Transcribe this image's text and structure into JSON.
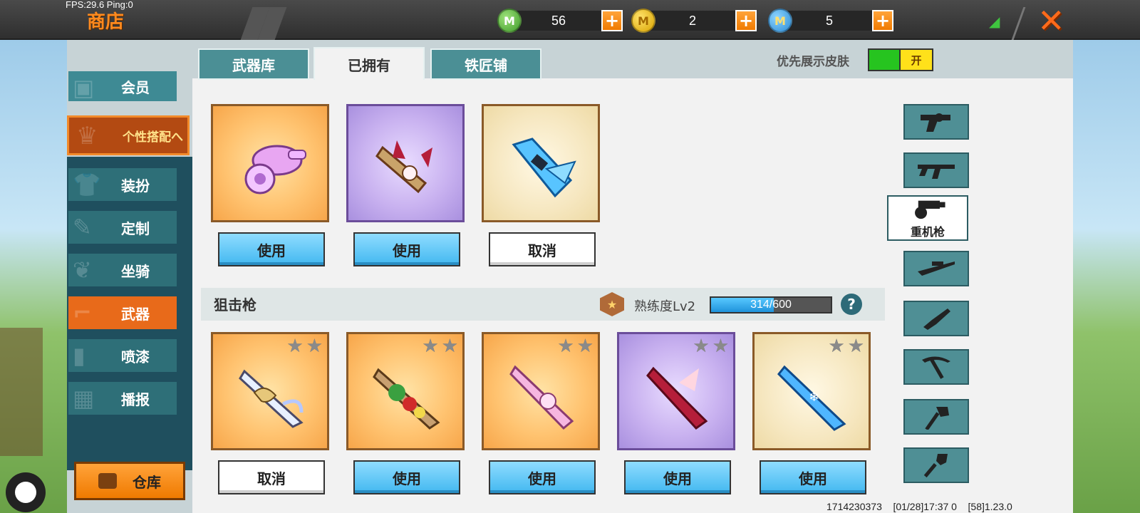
{
  "status": {
    "fps": "FPS:29.6  Ping:0"
  },
  "header": {
    "title": "商店",
    "currencies": [
      {
        "icon": "green-gem-icon",
        "value": "56"
      },
      {
        "icon": "gold-coin-icon",
        "value": "2"
      },
      {
        "icon": "blue-coin-icon",
        "value": "5"
      }
    ]
  },
  "sidebar": {
    "member": "会员",
    "group": "个性搭配へ",
    "items": [
      {
        "label": "装扮"
      },
      {
        "label": "定制"
      },
      {
        "label": "坐骑"
      },
      {
        "label": "武器"
      },
      {
        "label": "喷漆"
      },
      {
        "label": "播报"
      }
    ],
    "active_item": "武器",
    "warehouse": "仓库"
  },
  "tabs": [
    {
      "label": "武器库"
    },
    {
      "label": "已拥有"
    },
    {
      "label": "铁匠铺"
    }
  ],
  "active_tab": "已拥有",
  "skin_toggle": {
    "label": "优先展示皮肤",
    "state": "开"
  },
  "top_row": [
    {
      "button": "使用",
      "style": "orange",
      "item_icon": "pink-cannon-icon"
    },
    {
      "button": "使用",
      "style": "purple",
      "item_icon": "bunny-launcher-icon"
    },
    {
      "button": "取消",
      "style": "cream",
      "item_icon": "ice-gun-icon"
    }
  ],
  "section": {
    "title": "狙击枪",
    "mastery_label": "熟练度Lv2",
    "mastery_value": "314/600",
    "mastery_progress": 0.523
  },
  "sniper_row": [
    {
      "button": "取消",
      "style": "orange",
      "item_icon": "harp-sniper-icon"
    },
    {
      "button": "使用",
      "style": "orange",
      "item_icon": "festive-sniper-icon"
    },
    {
      "button": "使用",
      "style": "orange",
      "item_icon": "pink-sniper-icon"
    },
    {
      "button": "使用",
      "style": "purple",
      "item_icon": "crimson-sniper-icon"
    },
    {
      "button": "使用",
      "style": "cream",
      "item_icon": "snowflake-sniper-icon"
    }
  ],
  "categories": [
    {
      "icon": "revolver-icon"
    },
    {
      "icon": "rifle-icon"
    },
    {
      "icon": "heavy-machine-gun-icon",
      "label": "重机枪"
    },
    {
      "icon": "sniper-rifle-icon"
    },
    {
      "icon": "knife-icon"
    },
    {
      "icon": "pickaxe-icon"
    },
    {
      "icon": "axe-icon"
    },
    {
      "icon": "shovel-icon"
    }
  ],
  "footer": {
    "id": "1714230373",
    "time": "[01/28]17:37 0",
    "version": "[58]1.23.0"
  },
  "colors": {
    "accent": "#f07a00",
    "teal": "#4b8f95",
    "use_button": "#42b8f0"
  }
}
